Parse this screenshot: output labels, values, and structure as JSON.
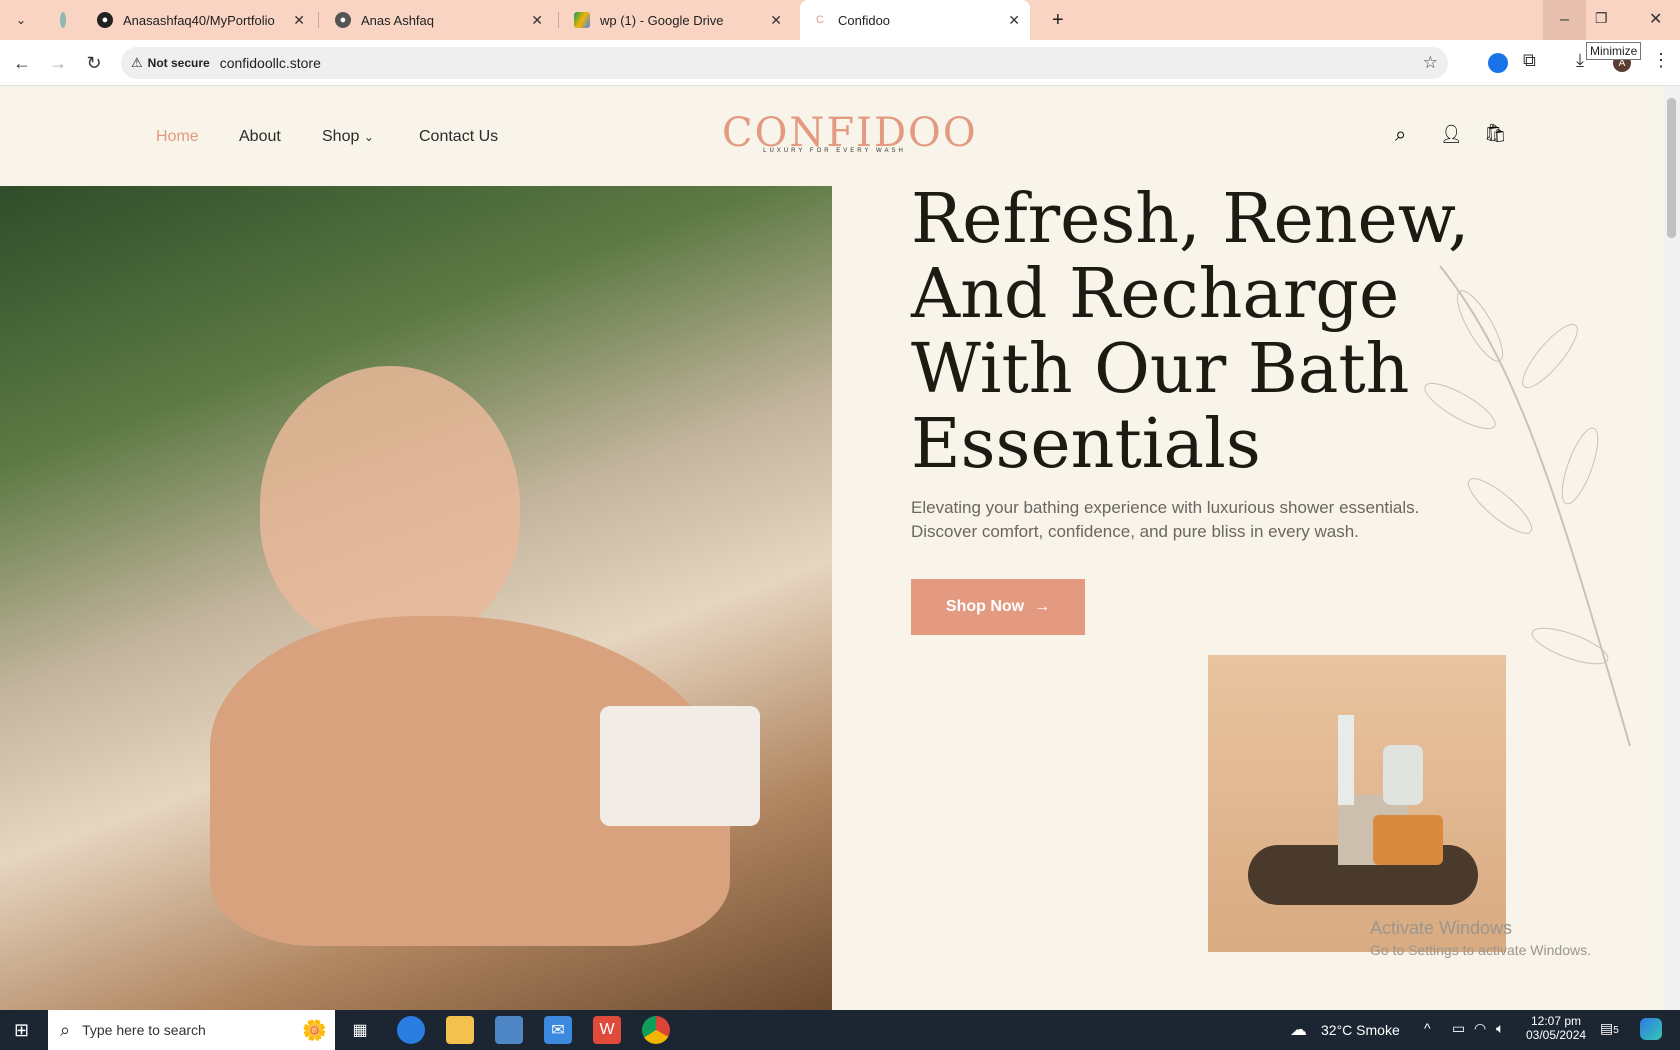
{
  "browser": {
    "tabs": [
      {
        "label": "Anasashfaq40/MyPortfolio",
        "icon": "github-icon"
      },
      {
        "label": "Anas Ashfaq",
        "icon": "globe-icon"
      },
      {
        "label": "wp (1) - Google Drive",
        "icon": "google-drive-icon"
      },
      {
        "label": "Confidoo",
        "icon": "confidoo-icon"
      }
    ],
    "security": "Not secure",
    "url": "confidoollc.store",
    "tooltip": "Minimize"
  },
  "site": {
    "nav": [
      "Home",
      "About",
      "Shop",
      "Contact Us"
    ],
    "logo_text": "CONFIDOO",
    "logo_tagline": "LUXURY FOR EVERY WASH",
    "headline": "Refresh, Renew, And Recharge With Our Bath Essentials",
    "lead": "Elevating your bathing experience with luxurious shower essentials. Discover comfort, confidence, and pure bliss in every wash.",
    "cta": "Shop Now",
    "accent": "#e39a81"
  },
  "watermark": {
    "title": "Activate Windows",
    "subtitle": "Go to Settings to activate Windows."
  },
  "taskbar": {
    "search_placeholder": "Type here to search",
    "weather": "32°C Smoke",
    "time": "12:07 pm",
    "date": "03/05/2024",
    "notifications": "5"
  }
}
